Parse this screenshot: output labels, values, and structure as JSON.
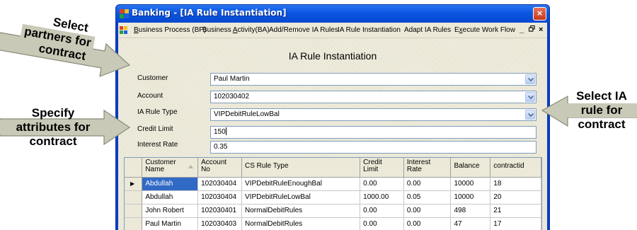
{
  "window": {
    "title": "Banking - [IA Rule Instantiation]",
    "close_glyph": "×"
  },
  "menu": {
    "items": [
      {
        "label": "Business Process (BP)",
        "underline": "B"
      },
      {
        "label": "Business Activity(BA)",
        "underline": "A"
      },
      {
        "label": "Add/Remove IA Rules"
      },
      {
        "label": "IA Rule Instantiation"
      },
      {
        "label": "Adapt IA Rules"
      },
      {
        "label": "Execute Work Flow",
        "underline": "x"
      }
    ],
    "minimize": "_",
    "restore": "Ÿ",
    "close": "×"
  },
  "form": {
    "title": "IA Rule Instantiation",
    "fields": [
      {
        "label": "Customer",
        "value": "Paul Martin",
        "type": "combo"
      },
      {
        "label": "Account",
        "value": "102030402",
        "type": "combo"
      },
      {
        "label": "IA Rule Type",
        "value": "VIPDebitRuleLowBal",
        "type": "combo"
      },
      {
        "label": "Credit Limit",
        "value": "150",
        "type": "text",
        "focused": true
      },
      {
        "label": "Interest Rate",
        "value": "0.35",
        "type": "text"
      }
    ]
  },
  "grid": {
    "columns": [
      {
        "label": "Customer\nName",
        "sorted": true
      },
      {
        "label": "Account\nNo"
      },
      {
        "label": "CS Rule Type"
      },
      {
        "label": "Credit\nLimit"
      },
      {
        "label": "Interest\nRate"
      },
      {
        "label": "Balance"
      },
      {
        "label": "contractid"
      }
    ],
    "rows": [
      {
        "current": true,
        "cells": [
          "Abdullah",
          "102030404",
          "VIPDebitRuleEnoughBal",
          "0.00",
          "0.00",
          "10000",
          "18"
        ]
      },
      {
        "current": false,
        "cells": [
          "Abdullah",
          "102030404",
          "VIPDebitRuleLowBal",
          "1000.00",
          "0.05",
          "10000",
          "20"
        ]
      },
      {
        "current": false,
        "cells": [
          "John Robert",
          "102030401",
          "NormalDebitRules",
          "0.00",
          "0.00",
          "498",
          "21"
        ]
      },
      {
        "current": false,
        "cells": [
          "Paul Martin",
          "102030403",
          "NormalDebitRules",
          "0.00",
          "0.00",
          "47",
          "17"
        ]
      }
    ],
    "current_row_marker": "▶"
  },
  "annotations": {
    "select_partners": [
      "Select",
      "partners for",
      "contract"
    ],
    "specify_attributes": [
      "Specify",
      "attributes for",
      "contract"
    ],
    "select_rule": [
      "Select IA",
      "rule for",
      "contract"
    ]
  },
  "colors": {
    "titlebar": "#0a55e0",
    "selection": "#316ac5",
    "callout_arrow": "#c9c9b7"
  }
}
